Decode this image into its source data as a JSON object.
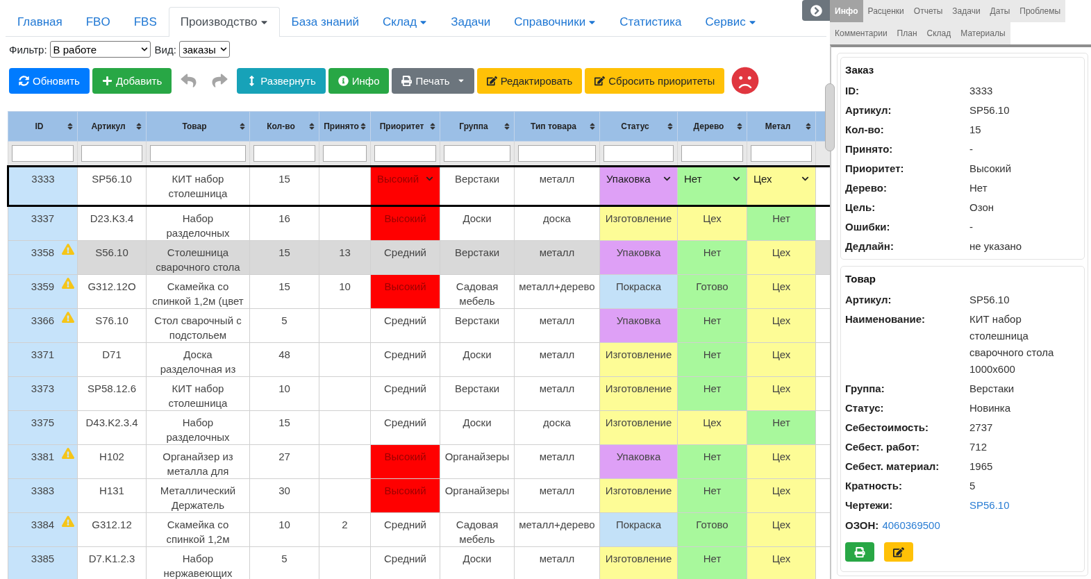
{
  "nav": {
    "tabs": [
      {
        "label": "Главная",
        "selected": false,
        "dropdown": false
      },
      {
        "label": "FBO",
        "selected": false,
        "dropdown": false
      },
      {
        "label": "FBS",
        "selected": false,
        "dropdown": false
      },
      {
        "label": "Производство",
        "selected": true,
        "dropdown": true
      },
      {
        "label": "База знаний",
        "selected": false,
        "dropdown": false
      },
      {
        "label": "Склад",
        "selected": false,
        "dropdown": true
      },
      {
        "label": "Задачи",
        "selected": false,
        "dropdown": false
      },
      {
        "label": "Справочники",
        "selected": false,
        "dropdown": true
      },
      {
        "label": "Статистика",
        "selected": false,
        "dropdown": false
      },
      {
        "label": "Сервис",
        "selected": false,
        "dropdown": true
      }
    ]
  },
  "filters": [
    {
      "label": "Фильтр:",
      "value": "В работе"
    },
    {
      "label": "Вид:",
      "value": "заказы"
    }
  ],
  "toolbar": {
    "buttons": [
      {
        "kind": "refresh",
        "label": "Обновить"
      },
      {
        "kind": "add",
        "label": "Добавить"
      },
      {
        "kind": "undo"
      },
      {
        "kind": "redo"
      },
      {
        "kind": "expand",
        "label": "Развернуть"
      },
      {
        "kind": "info",
        "label": "Инфо"
      },
      {
        "kind": "print",
        "label": "Печать"
      },
      {
        "kind": "edit",
        "label": "Редактировать"
      },
      {
        "kind": "reset",
        "label": "Сбросить приоритеты"
      }
    ]
  },
  "table": {
    "columns": [
      "ID",
      "Артикул",
      "Товар",
      "Кол-во",
      "Принято",
      "Приоритет",
      "Группа",
      "Тип товара",
      "Статус",
      "Дерево",
      "Метал"
    ],
    "rows": [
      {
        "id": "3333",
        "warning": false,
        "selected": true,
        "shaded": false,
        "article": "SP56.10",
        "product": "КИТ набор столешница",
        "qty": "15",
        "priority": {
          "text": "Высокий",
          "color": "#ff0000"
        },
        "group": "Верстаки",
        "type": "металл",
        "status": {
          "text": "Упаковка",
          "color": "#dea0f6"
        },
        "wood": {
          "text": "Нет",
          "color": "#a8f89c"
        },
        "metal": {
          "text": "Цех",
          "color": "#fdfc96"
        }
      },
      {
        "id": "3337",
        "warning": false,
        "selected": false,
        "shaded": false,
        "article": "D23.K3.4",
        "product": "Набор разделочных",
        "qty": "16",
        "priority": {
          "text": "Высокий",
          "color": "#ff0000"
        },
        "group": "Доски",
        "type": "доска",
        "status": {
          "text": "Изготовление",
          "color": "#fdfc96"
        },
        "wood": {
          "text": "Цех",
          "color": "#fdfc96"
        },
        "metal": {
          "text": "Нет",
          "color": "#a8f89c"
        }
      },
      {
        "id": "3358",
        "warning": true,
        "selected": false,
        "shaded": true,
        "article": "S56.10",
        "product": "Столешница сварочного стола",
        "qty": "15",
        "accepted": "13",
        "priority": {
          "text": "Средний"
        },
        "group": "Верстаки",
        "type": "металл",
        "status": {
          "text": "Упаковка",
          "color": "#dea0f6"
        },
        "wood": {
          "text": "Нет",
          "color": "#a8f89c"
        },
        "metal": {
          "text": "Цех",
          "color": "#fdfc96"
        }
      },
      {
        "id": "3359",
        "warning": true,
        "selected": false,
        "shaded": false,
        "article": "G312.12O",
        "product": "Скамейка со спинкой 1,2м (цвет",
        "qty": "15",
        "accepted": "10",
        "priority": {
          "text": "Высокий",
          "color": "#ff0000"
        },
        "group": "Садовая мебель",
        "type": "металл+дерево",
        "status": {
          "text": "Покраска",
          "color": "#c3e1f8"
        },
        "wood": {
          "text": "Готово",
          "color": "#a8f89c"
        },
        "metal": {
          "text": "Цех",
          "color": "#fdfc96"
        }
      },
      {
        "id": "3366",
        "warning": true,
        "selected": false,
        "shaded": false,
        "article": "S76.10",
        "product": "Стол сварочный с подстольем",
        "qty": "5",
        "priority": {
          "text": "Средний"
        },
        "group": "Верстаки",
        "type": "металл",
        "status": {
          "text": "Упаковка",
          "color": "#dea0f6"
        },
        "wood": {
          "text": "Нет",
          "color": "#a8f89c"
        },
        "metal": {
          "text": "Цех",
          "color": "#fdfc96"
        }
      },
      {
        "id": "3371",
        "warning": false,
        "selected": false,
        "shaded": false,
        "article": "D71",
        "product": "Доска разделочная из",
        "qty": "48",
        "priority": {
          "text": "Средний"
        },
        "group": "Доски",
        "type": "металл",
        "status": {
          "text": "Изготовление",
          "color": "#fdfc96"
        },
        "wood": {
          "text": "Нет",
          "color": "#a8f89c"
        },
        "metal": {
          "text": "Цех",
          "color": "#fdfc96"
        }
      },
      {
        "id": "3373",
        "warning": false,
        "selected": false,
        "shaded": false,
        "article": "SP58.12.6",
        "product": "КИТ набор столешница",
        "qty": "10",
        "priority": {
          "text": "Средний"
        },
        "group": "Верстаки",
        "type": "металл",
        "status": {
          "text": "Изготовление",
          "color": "#fdfc96"
        },
        "wood": {
          "text": "Нет",
          "color": "#a8f89c"
        },
        "metal": {
          "text": "Цех",
          "color": "#fdfc96"
        }
      },
      {
        "id": "3375",
        "warning": false,
        "selected": false,
        "shaded": false,
        "article": "D43.K2.3.4",
        "product": "Набор разделочных",
        "qty": "15",
        "priority": {
          "text": "Средний"
        },
        "group": "Доски",
        "type": "доска",
        "status": {
          "text": "Изготовление",
          "color": "#fdfc96"
        },
        "wood": {
          "text": "Цех",
          "color": "#fdfc96"
        },
        "metal": {
          "text": "Нет",
          "color": "#a8f89c"
        }
      },
      {
        "id": "3381",
        "warning": true,
        "selected": false,
        "shaded": false,
        "article": "H102",
        "product": "Органайзер из металла для",
        "qty": "27",
        "priority": {
          "text": "Высокий",
          "color": "#ff0000"
        },
        "group": "Органайзеры",
        "type": "металл",
        "status": {
          "text": "Упаковка",
          "color": "#dea0f6"
        },
        "wood": {
          "text": "Нет",
          "color": "#a8f89c"
        },
        "metal": {
          "text": "Цех",
          "color": "#fdfc96"
        }
      },
      {
        "id": "3383",
        "warning": false,
        "selected": false,
        "shaded": false,
        "article": "H131",
        "product": "Металлический Держатель",
        "qty": "30",
        "priority": {
          "text": "Высокий",
          "color": "#ff0000"
        },
        "group": "Органайзеры",
        "type": "металл",
        "status": {
          "text": "Изготовление",
          "color": "#fdfc96"
        },
        "wood": {
          "text": "Нет",
          "color": "#a8f89c"
        },
        "metal": {
          "text": "Цех",
          "color": "#fdfc96"
        }
      },
      {
        "id": "3384",
        "warning": true,
        "selected": false,
        "shaded": false,
        "article": "G312.12",
        "product": "Скамейка со спинкой 1,2м",
        "qty": "10",
        "accepted": "2",
        "priority": {
          "text": "Средний"
        },
        "group": "Садовая мебель",
        "type": "металл+дерево",
        "status": {
          "text": "Покраска",
          "color": "#c3e1f8"
        },
        "wood": {
          "text": "Готово",
          "color": "#a8f89c"
        },
        "metal": {
          "text": "Цех",
          "color": "#fdfc96"
        }
      },
      {
        "id": "3385",
        "warning": false,
        "selected": false,
        "shaded": false,
        "article": "D7.K1.2.3",
        "product": "Набор нержавеющих",
        "qty": "5",
        "priority": {
          "text": "Средний"
        },
        "group": "Доски",
        "type": "металл",
        "status": {
          "text": "Изготовление",
          "color": "#fdfc96"
        },
        "wood": {
          "text": "Нет",
          "color": "#a8f89c"
        },
        "metal": {
          "text": "Цех",
          "color": "#fdfc96"
        }
      }
    ]
  },
  "side_panel": {
    "tabs": [
      {
        "label": "Инфо",
        "selected": true
      },
      {
        "label": "Расценки",
        "selected": false
      },
      {
        "label": "Отчеты",
        "selected": false
      },
      {
        "label": "Задачи",
        "selected": false
      },
      {
        "label": "Даты",
        "selected": false
      },
      {
        "label": "Проблемы",
        "selected": false
      },
      {
        "label": "Комментарии",
        "selected": false
      },
      {
        "label": "План",
        "selected": false
      },
      {
        "label": "Склад",
        "selected": false
      },
      {
        "label": "Материалы",
        "selected": false
      }
    ],
    "order_card": {
      "title": "Заказ",
      "fields": [
        {
          "kind": "text",
          "label": "ID:",
          "value": "3333"
        },
        {
          "kind": "text",
          "label": "Артикул:",
          "value": "SP56.10"
        },
        {
          "kind": "text",
          "label": "Кол-во:",
          "value": "15"
        },
        {
          "kind": "text",
          "label": "Принято:",
          "value": "-"
        },
        {
          "kind": "text",
          "label": "Приоритет:",
          "value": "Высокий"
        },
        {
          "kind": "text",
          "label": "Дерево:",
          "value": "Нет"
        },
        {
          "kind": "text",
          "label": "Цель:",
          "value": "Озон"
        },
        {
          "kind": "text",
          "label": "Ошибки:",
          "value": "-"
        },
        {
          "kind": "text",
          "label": "Дедлайн:",
          "value": "не указано"
        }
      ]
    },
    "product_card": {
      "title": "Товар",
      "fields": [
        {
          "kind": "text",
          "label": "Артикул:",
          "value": "SP56.10"
        },
        {
          "kind": "text",
          "label": "Наименование:",
          "value": "КИТ набор столешница сварочного стола 1000x600"
        },
        {
          "kind": "text",
          "label": "Группа:",
          "value": "Верстаки"
        },
        {
          "kind": "text",
          "label": "Статус:",
          "value": "Новинка"
        },
        {
          "kind": "text",
          "label": "Себестоимость:",
          "value": "2737"
        },
        {
          "kind": "text",
          "label": "Себест. работ:",
          "value": "712"
        },
        {
          "kind": "text",
          "label": "Себест. материал:",
          "value": "1965"
        },
        {
          "kind": "text",
          "label": "Кратность:",
          "value": "5"
        },
        {
          "kind": "link",
          "label": "Чертежи:",
          "value": "SP56.10"
        }
      ],
      "ozon": {
        "label": "ОЗОН:",
        "value": "4060369500"
      },
      "actions": [
        {
          "kind": "print"
        },
        {
          "kind": "edit"
        }
      ]
    }
  }
}
